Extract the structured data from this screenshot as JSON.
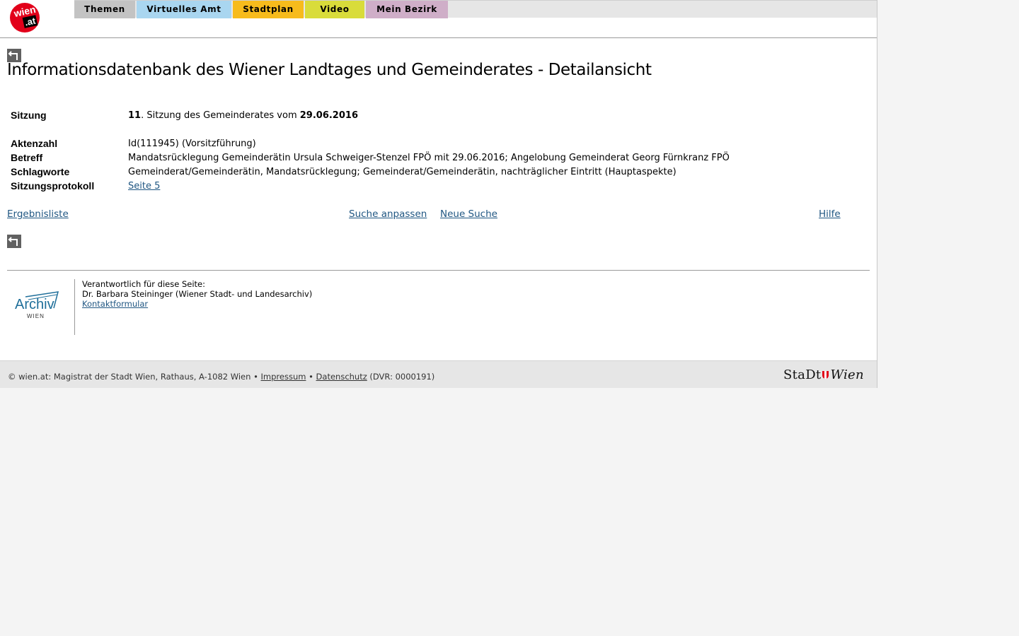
{
  "header": {
    "logo_main": "wien",
    "logo_sub": ".at",
    "nav": [
      {
        "label": "Themen",
        "color": "#c3c3c3"
      },
      {
        "label": "Virtuelles Amt",
        "color": "#a9d6f0"
      },
      {
        "label": "Stadtplan",
        "color": "#f7bb1c"
      },
      {
        "label": "Video",
        "color": "#d9dc3a"
      },
      {
        "label": "Mein Bezirk",
        "color": "#cfaec8"
      }
    ]
  },
  "page_title": "Informationsdatenbank des Wiener Landtages und Gemeinderates - Detailansicht",
  "session": {
    "label": "Sitzung",
    "number": "11",
    "text_mid": ". Sitzung des Gemeinderates vom ",
    "date": "29.06.2016"
  },
  "details": {
    "aktenzahl_label": "Aktenzahl",
    "aktenzahl_value": "Id(111945)  (Vorsitzführung)",
    "betreff_label": "Betreff",
    "betreff_value": "Mandatsrücklegung Gemeinderätin Ursula Schweiger-Stenzel FPÖ mit 29.06.2016; Angelobung Gemeinderat Georg Fürnkranz FPÖ",
    "schlagworte_label": "Schlagworte",
    "schlagworte_value": "Gemeinderat/Gemeinderätin, Mandatsrücklegung; Gemeinderat/Gemeinderätin, nachträglicher Eintritt (Hauptaspekte)",
    "protokoll_label": "Sitzungsprotokoll",
    "protokoll_link": "Seite 5"
  },
  "links": {
    "ergebnisliste": "Ergebnisliste",
    "suche_anpassen": "Suche anpassen",
    "neue_suche": "Neue Suche",
    "hilfe": "Hilfe"
  },
  "responsible": {
    "archiv_logo_text": "Archiv",
    "archiv_logo_sub": "WIEN",
    "heading": "Verantwortlich für diese Seite:",
    "person": "Dr. Barbara Steininger (Wiener Stadt- und Landesarchiv)",
    "contact_link": "Kontaktformular"
  },
  "footer": {
    "text_before": "© wien.at: Magistrat der Stadt Wien, Rathaus, A-1082 Wien • ",
    "impressum": "Impressum",
    "separator": " • ",
    "datenschutz": "Datenschutz",
    "text_after": " (DVR: 0000191)",
    "logo_left": "StaDt",
    "logo_right": "Wien"
  },
  "icons": {
    "back": "back-arrow-icon"
  }
}
